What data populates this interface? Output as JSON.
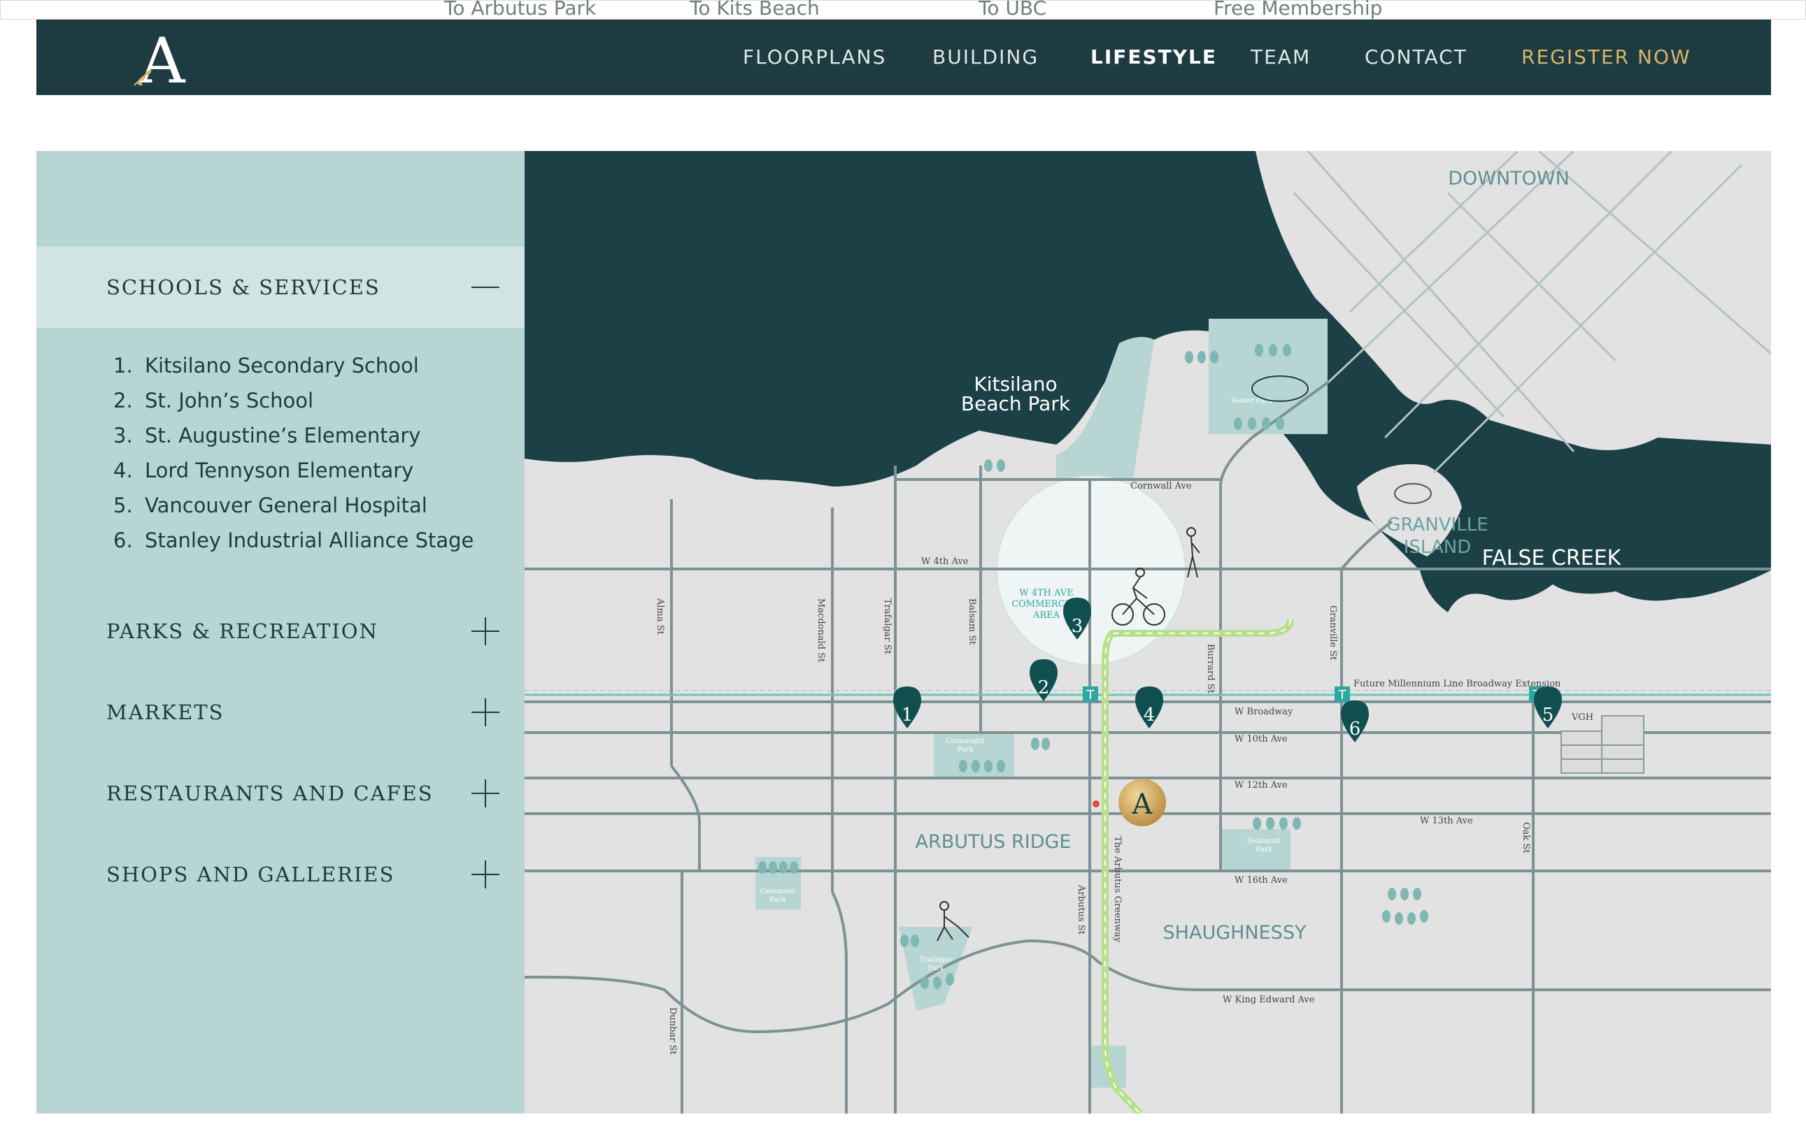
{
  "top_links": [
    "To Arbutus Park",
    "To Kits Beach",
    "To UBC",
    "Free Membership"
  ],
  "header": {
    "logo_letter": "A",
    "nav": [
      {
        "label": "FLOORPLANS",
        "active": false
      },
      {
        "label": "BUILDING",
        "active": false
      },
      {
        "label": "LIFESTYLE",
        "active": true
      },
      {
        "label": "TEAM",
        "active": false
      },
      {
        "label": "CONTACT",
        "active": false
      },
      {
        "label": "REGISTER NOW",
        "active": false,
        "highlight": true
      }
    ]
  },
  "sidebar": {
    "sections": [
      {
        "title": "SCHOOLS & SERVICES",
        "expanded": true
      },
      {
        "title": "PARKS & RECREATION",
        "expanded": false
      },
      {
        "title": "MARKETS",
        "expanded": false
      },
      {
        "title": "RESTAURANTS AND CAFES",
        "expanded": false
      },
      {
        "title": "SHOPS AND GALLERIES",
        "expanded": false
      }
    ],
    "poi_items": [
      {
        "num": "1.",
        "label": "Kitsilano Secondary School"
      },
      {
        "num": "2.",
        "label": "St. John’s School"
      },
      {
        "num": "3.",
        "label": "St. Augustine’s Elementary"
      },
      {
        "num": "4.",
        "label": "Lord Tennyson Elementary"
      },
      {
        "num": "5.",
        "label": "Vancouver General Hospital"
      },
      {
        "num": "6.",
        "label": "Stanley Industrial Alliance Stage"
      }
    ]
  },
  "map": {
    "areas": {
      "downtown": "DOWNTOWN",
      "granville_island": [
        "GRANVILLE",
        "ISLAND"
      ],
      "false_creek": "FALSE CREEK",
      "kits_beach": [
        "Kitsilano",
        "Beach Park"
      ],
      "commercial": [
        "W 4TH AVE",
        "COMMERCIAL",
        "AREA"
      ],
      "arbutus_ridge": "ARBUTUS RIDGE",
      "shaughnessy": "SHAUGHNESSY"
    },
    "streets": {
      "cornwall": "Cornwall Ave",
      "w4th": "W 4th Ave",
      "broadway": "W Broadway",
      "w10th": "W 10th Ave",
      "w12th": "W 12th Ave",
      "w13th": "W 13th Ave",
      "w16th": "W 16th Ave",
      "king_edward": "W King Edward Ave",
      "alma": "Alma St",
      "macdonald": "Macdonald St",
      "trafalgar": "Trafalgar St",
      "balsam": "Balsam St",
      "burrard": "Burrard St",
      "granville": "Granville St",
      "oak": "Oak St",
      "arbutus": "Arbutus St",
      "greenway": "The Arbutus Greenway",
      "dunbar": "Dunbar St"
    },
    "transit_label": "Future Millennium Line Broadway Extension",
    "transit_stop_glyph": "T",
    "vgh_label": "VGH",
    "pins": [
      "1",
      "2",
      "3",
      "4",
      "5",
      "6"
    ],
    "building_logo": "A",
    "parks": {
      "vanier": "Vanier Park",
      "connaught": [
        "Connaught",
        "Park"
      ],
      "cessaroni": [
        "Cessaroni",
        "Park"
      ],
      "trafalgar": [
        "Trafalgar",
        "Park"
      ],
      "delamont": [
        "Delamont",
        "Park"
      ]
    },
    "colors": {
      "water": "#1b4146",
      "land": "#e2e2e2",
      "road": "#7e9293",
      "park": "#b7d5d2",
      "pin": "#0f4f50",
      "greenway": "#b8df8e",
      "transit": "#6cc6c0"
    }
  }
}
